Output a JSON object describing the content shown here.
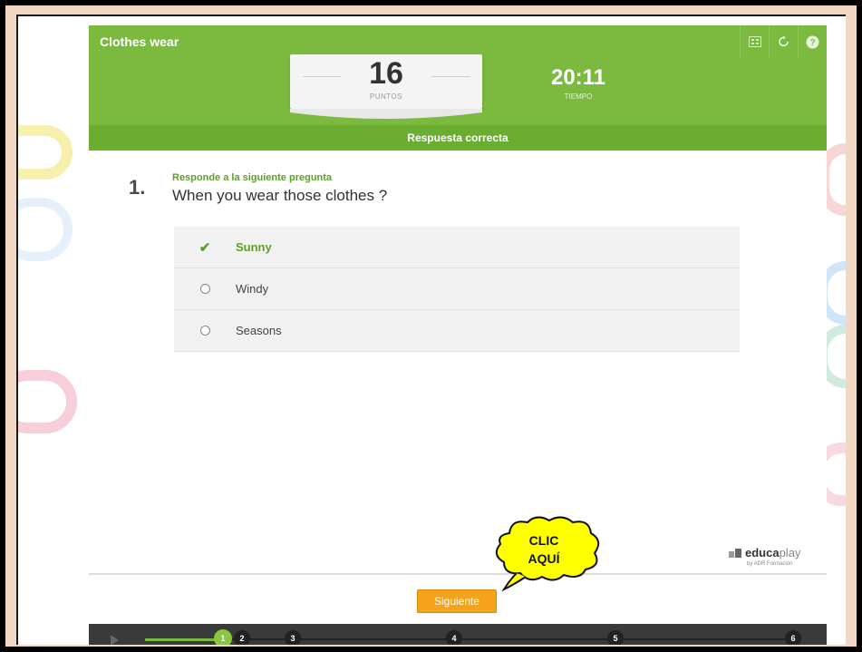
{
  "app": {
    "title": "Clothes wear",
    "icons": [
      "fullscreen-icon",
      "restart-icon",
      "help-icon"
    ]
  },
  "score": {
    "value": "16",
    "label": "PUNTOS"
  },
  "timer": {
    "value": "20:11",
    "label": "TIEMPO"
  },
  "feedback": "Respuesta correcta",
  "question": {
    "number": "1.",
    "instruction": "Responde a la siguiente pregunta",
    "text": "When you wear those clothes ?",
    "options": [
      {
        "label": "Sunny",
        "state": "correct"
      },
      {
        "label": "Windy",
        "state": "unselected"
      },
      {
        "label": "Seasons",
        "state": "unselected"
      }
    ]
  },
  "logo": {
    "name_a": "educa",
    "name_b": "play",
    "tagline": "by ADR Formación"
  },
  "annotation": {
    "line1": "CLIC",
    "line2": "AQUÍ"
  },
  "next_button": "Siguiente",
  "progress": {
    "steps": [
      "1",
      "2",
      "3",
      "4",
      "5",
      "6"
    ],
    "current": 1
  },
  "colors": {
    "header_green": "#7bba3e",
    "feedback_green": "#6aad31",
    "button_orange": "#f5a31a",
    "callout_yellow": "#ffff00"
  }
}
